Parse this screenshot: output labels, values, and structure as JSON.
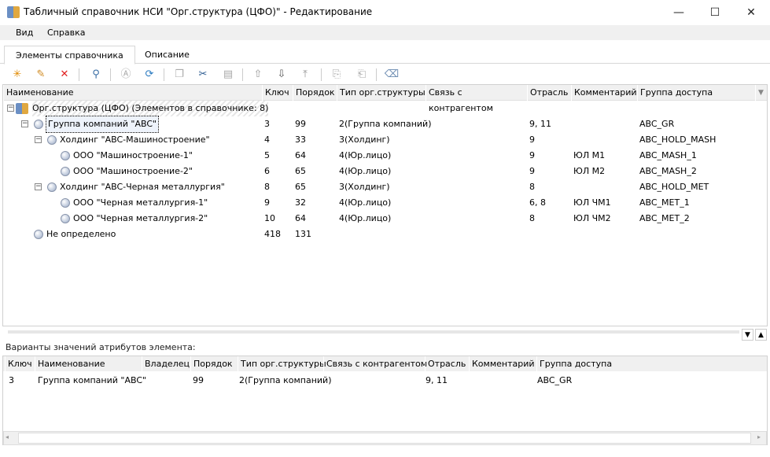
{
  "window": {
    "title": "Табличный справочник НСИ \"Орг.структура (ЦФО)\" - Редактирование",
    "minimize": "—",
    "maximize": "☐",
    "close": "✕"
  },
  "menu": [
    "Вид",
    "Справка"
  ],
  "tabs": [
    {
      "label": "Элементы справочника",
      "active": true
    },
    {
      "label": "Описание",
      "active": false
    }
  ],
  "toolbar": [
    "new-element",
    "edit",
    "delete",
    "find",
    "attribute-values",
    "refresh",
    "copy",
    "cut",
    "paste",
    "move-up",
    "move-down",
    "move-to-top",
    "export",
    "import",
    "clear"
  ],
  "grid": {
    "columns": [
      "Наименование",
      "Ключ",
      "Порядок",
      "Тип орг.структуры",
      "Связь с контрагентом",
      "Отрасль",
      "Комментарий",
      "Группа доступа"
    ],
    "root": "Орг.структура (ЦФО) (Элементов в справочнике: 8)",
    "rows": [
      {
        "level": 1,
        "expanded": true,
        "name": "Группа компаний \"ABC\"",
        "key": "3",
        "order": "99",
        "type": "2(Группа компаний)",
        "link": "",
        "industry": "9, 11",
        "comment": "",
        "group": "ABC_GR",
        "selected": true
      },
      {
        "level": 2,
        "expanded": true,
        "name": "Холдинг \"ABC-Машиностроение\"",
        "key": "4",
        "order": "33",
        "type": "3(Холдинг)",
        "link": "",
        "industry": "9",
        "comment": "",
        "group": "ABC_HOLD_MASH"
      },
      {
        "level": 3,
        "name": "ООО \"Машиностроение-1\"",
        "key": "5",
        "order": "64",
        "type": "4(Юр.лицо)",
        "link": "",
        "industry": "9",
        "comment": "ЮЛ М1",
        "group": "ABC_MASH_1"
      },
      {
        "level": 3,
        "name": "ООО \"Машиностроение-2\"",
        "key": "6",
        "order": "65",
        "type": "4(Юр.лицо)",
        "link": "",
        "industry": "9",
        "comment": "ЮЛ М2",
        "group": "ABC_MASH_2"
      },
      {
        "level": 2,
        "expanded": true,
        "name": "Холдинг \"ABC-Черная металлургия\"",
        "key": "8",
        "order": "65",
        "type": "3(Холдинг)",
        "link": "",
        "industry": "8",
        "comment": "",
        "group": "ABC_HOLD_MET"
      },
      {
        "level": 3,
        "name": "ООО \"Черная металлургия-1\"",
        "key": "9",
        "order": "32",
        "type": "4(Юр.лицо)",
        "link": "",
        "industry": "6, 8",
        "comment": "ЮЛ ЧМ1",
        "group": "ABC_MET_1"
      },
      {
        "level": 3,
        "name": "ООО \"Черная металлургия-2\"",
        "key": "10",
        "order": "64",
        "type": "4(Юр.лицо)",
        "link": "",
        "industry": "8",
        "comment": "ЮЛ ЧМ2",
        "group": "ABC_MET_2"
      },
      {
        "level": 1,
        "name": "Не определено",
        "key": "418",
        "order": "131",
        "type": "",
        "link": "",
        "industry": "",
        "comment": "",
        "group": ""
      }
    ]
  },
  "attributes": {
    "label": "Варианты значений атрибутов элемента:",
    "columns": [
      "Ключ",
      "Наименование",
      "Владелец",
      "Порядок",
      "Тип орг.структуры",
      "Связь с контрагентом",
      "Отрасль",
      "Комментарий",
      "Группа доступа"
    ],
    "rows": [
      [
        "3",
        "Группа компаний \"ABC\"",
        "",
        "99",
        "2(Группа компаний)",
        "",
        "9, 11",
        "",
        "ABC_GR"
      ]
    ]
  }
}
